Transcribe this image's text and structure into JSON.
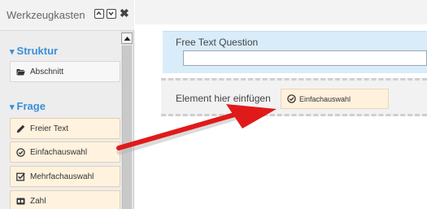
{
  "toolbox": {
    "title": "Werkzeugkasten",
    "sections": [
      {
        "label": "Struktur",
        "items": [
          {
            "label": "Abschnitt",
            "icon": "folder-open-icon"
          }
        ]
      },
      {
        "label": "Frage",
        "items": [
          {
            "label": "Freier Text",
            "icon": "pencil-icon"
          },
          {
            "label": "Einfachauswahl",
            "icon": "radio-check-icon"
          },
          {
            "label": "Mehrfachauswahl",
            "icon": "checkbox-icon"
          },
          {
            "label": "Zahl",
            "icon": "number-icon"
          }
        ]
      }
    ]
  },
  "canvas": {
    "question": {
      "title": "Free Text Question",
      "input_value": ""
    },
    "drop_zone": {
      "text": "Element hier einfügen",
      "chip_label": "Einfachauswahl",
      "chip_icon": "radio-check-icon"
    }
  },
  "colors": {
    "accent": "#3a8fd8",
    "item_bg": "#fff3df",
    "question_bg": "#d9ecfa",
    "arrow": "#e01a1a"
  }
}
